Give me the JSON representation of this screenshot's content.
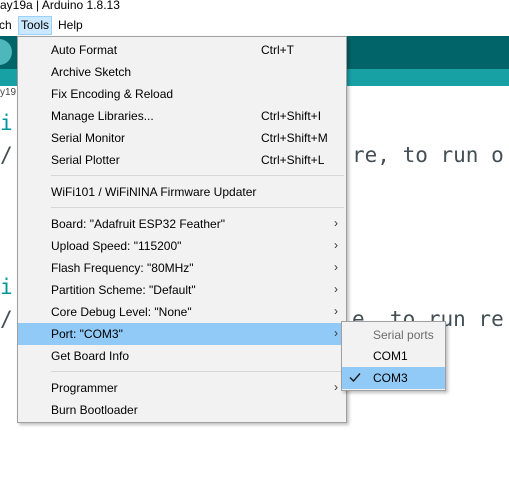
{
  "window": {
    "title_fragment": "ay19a | Arduino 1.8.13"
  },
  "menubar": {
    "items": [
      "ch",
      "Tools",
      "Help"
    ]
  },
  "sketch": {
    "tab_fragment": "y19"
  },
  "editor": {
    "lines": [
      {
        "text": "i"
      },
      {
        "text": "/"
      },
      {
        "text": "re, to run o"
      },
      {
        "text": "i"
      },
      {
        "text": "/"
      },
      {
        "text": "e, to run re"
      }
    ]
  },
  "tools_menu": {
    "items": [
      {
        "label": "Auto Format",
        "shortcut": "Ctrl+T"
      },
      {
        "label": "Archive Sketch",
        "shortcut": ""
      },
      {
        "label": "Fix Encoding & Reload",
        "shortcut": ""
      },
      {
        "label": "Manage Libraries...",
        "shortcut": "Ctrl+Shift+I"
      },
      {
        "label": "Serial Monitor",
        "shortcut": "Ctrl+Shift+M"
      },
      {
        "label": "Serial Plotter",
        "shortcut": "Ctrl+Shift+L"
      },
      {
        "label": "WiFi101 / WiFiNINA Firmware Updater",
        "shortcut": ""
      },
      {
        "label": "Board: \"Adafruit ESP32 Feather\"",
        "submenu": true
      },
      {
        "label": "Upload Speed: \"115200\"",
        "submenu": true
      },
      {
        "label": "Flash Frequency: \"80MHz\"",
        "submenu": true
      },
      {
        "label": "Partition Scheme: \"Default\"",
        "submenu": true
      },
      {
        "label": "Core Debug Level: \"None\"",
        "submenu": true
      },
      {
        "label": "Port: \"COM3\"",
        "submenu": true,
        "highlighted": true
      },
      {
        "label": "Get Board Info"
      },
      {
        "label": "Programmer",
        "submenu": true
      },
      {
        "label": "Burn Bootloader"
      }
    ]
  },
  "port_submenu": {
    "heading": "Serial ports",
    "items": [
      {
        "label": "COM1",
        "checked": false
      },
      {
        "label": "COM3",
        "checked": true
      }
    ]
  },
  "colors": {
    "toolbar": "#006468",
    "tabstrip": "#17a1a5",
    "menu_bg": "#f2f2f2",
    "highlight": "#91c9f7",
    "code_teal": "#00979c"
  }
}
